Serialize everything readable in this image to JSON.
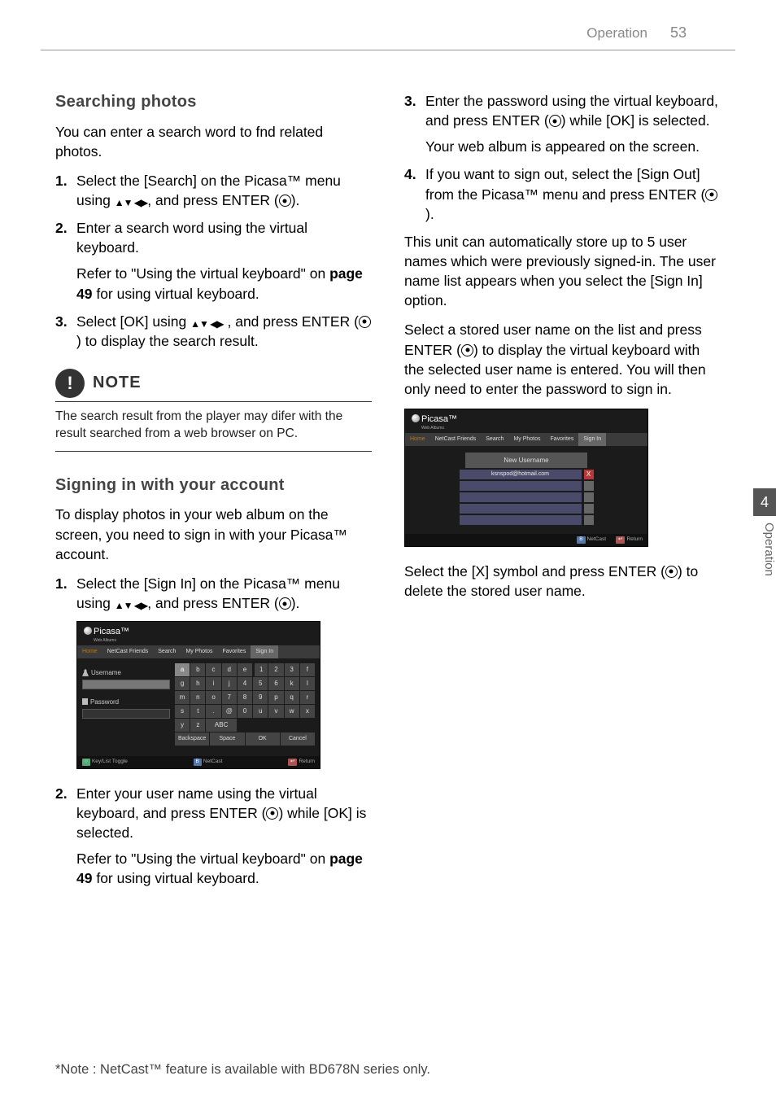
{
  "header": {
    "section": "Operation",
    "page": "53"
  },
  "left": {
    "h1": "Searching photos",
    "p1": "You can enter a search word to fnd related photos.",
    "steps": [
      {
        "n": "1.",
        "t": "Select the [Search] on the Picasa™ menu using ",
        "t2": ", and press ENTER (",
        "t3": ")."
      },
      {
        "n": "2.",
        "t": "Enter a search word using the virtual keyboard.",
        "sub": "Refer to \"Using the virtual keyboard\" on ",
        "subbold": "page 49",
        "sub2": " for using virtual keyboard."
      },
      {
        "n": "3.",
        "t": "Select [OK] using ",
        "t2": " , and press ENTER (",
        "t3": ") to display the search result."
      }
    ],
    "note": {
      "label": "NOTE",
      "body": "The search result from the player may difer with the result searched from a web browser on PC."
    },
    "h2": "Signing in with your account",
    "p2": "To display photos in your web album on the screen, you need to sign in with your Picasa™ account.",
    "steps2": [
      {
        "n": "1.",
        "t": "Select the [Sign In] on the Picasa™ menu using ",
        "t2": ", and press ENTER (",
        "t3": ")."
      },
      {
        "n": "2.",
        "t": "Enter your user name using the virtual keyboard, and press ENTER (",
        "t2": ") while [OK] is selected.",
        "sub": "Refer to \"Using the virtual keyboard\" on ",
        "subbold": "page 49",
        "sub2": " for using virtual keyboard."
      }
    ],
    "ss": {
      "logo": "Picasa",
      "logosub": "Web Albums",
      "tabs": [
        "Home",
        "NetCast Friends",
        "Search",
        "My Photos",
        "Favorites",
        "Sign In"
      ],
      "username": "Username",
      "password": "Password",
      "keys": [
        "a",
        "b",
        "c",
        "d",
        "e",
        "1",
        "2",
        "3",
        "f",
        "g",
        "h",
        "i",
        "j",
        "4",
        "5",
        "6",
        "k",
        "l",
        "m",
        "n",
        "o",
        "7",
        "8",
        "9",
        "p",
        "q",
        "r",
        "s",
        "t",
        ".",
        "@",
        "0",
        "u",
        "v",
        "w",
        "x",
        "y",
        "z",
        "ABC"
      ],
      "ops": [
        "Backspace",
        "Space",
        "OK",
        "Cancel"
      ],
      "footL": "Key/List Toggle",
      "footC": "NetCast",
      "footR": "Return"
    }
  },
  "right": {
    "steps": [
      {
        "n": "3.",
        "t": "Enter the password using the virtual keyboard, and press ENTER (",
        "t2": ") while [OK] is selected.",
        "sub": "Your web album is appeared on the screen."
      },
      {
        "n": "4.",
        "t": "If you want to sign out, select the [Sign Out] from the Picasa™ menu and press ENTER (",
        "t2": ")."
      }
    ],
    "p1": "This unit can automatically store up to 5 user names which were previously signed-in. The user name list appears when you select the [Sign In] option.",
    "p2a": "Select a stored user name on the list and press ENTER (",
    "p2b": ") to display the virtual keyboard with the selected user name is entered. You will then only need to enter the password to sign in.",
    "ss2": {
      "newUser": "New Username",
      "stored": "ksnspod@hotmail.com"
    },
    "p3a": "Select the [X] symbol and press ENTER (",
    "p3b": ") to delete the stored user name."
  },
  "side": {
    "num": "4",
    "label": "Operation"
  },
  "footnote": "*Note : NetCast™ feature is available with BD678N series only."
}
